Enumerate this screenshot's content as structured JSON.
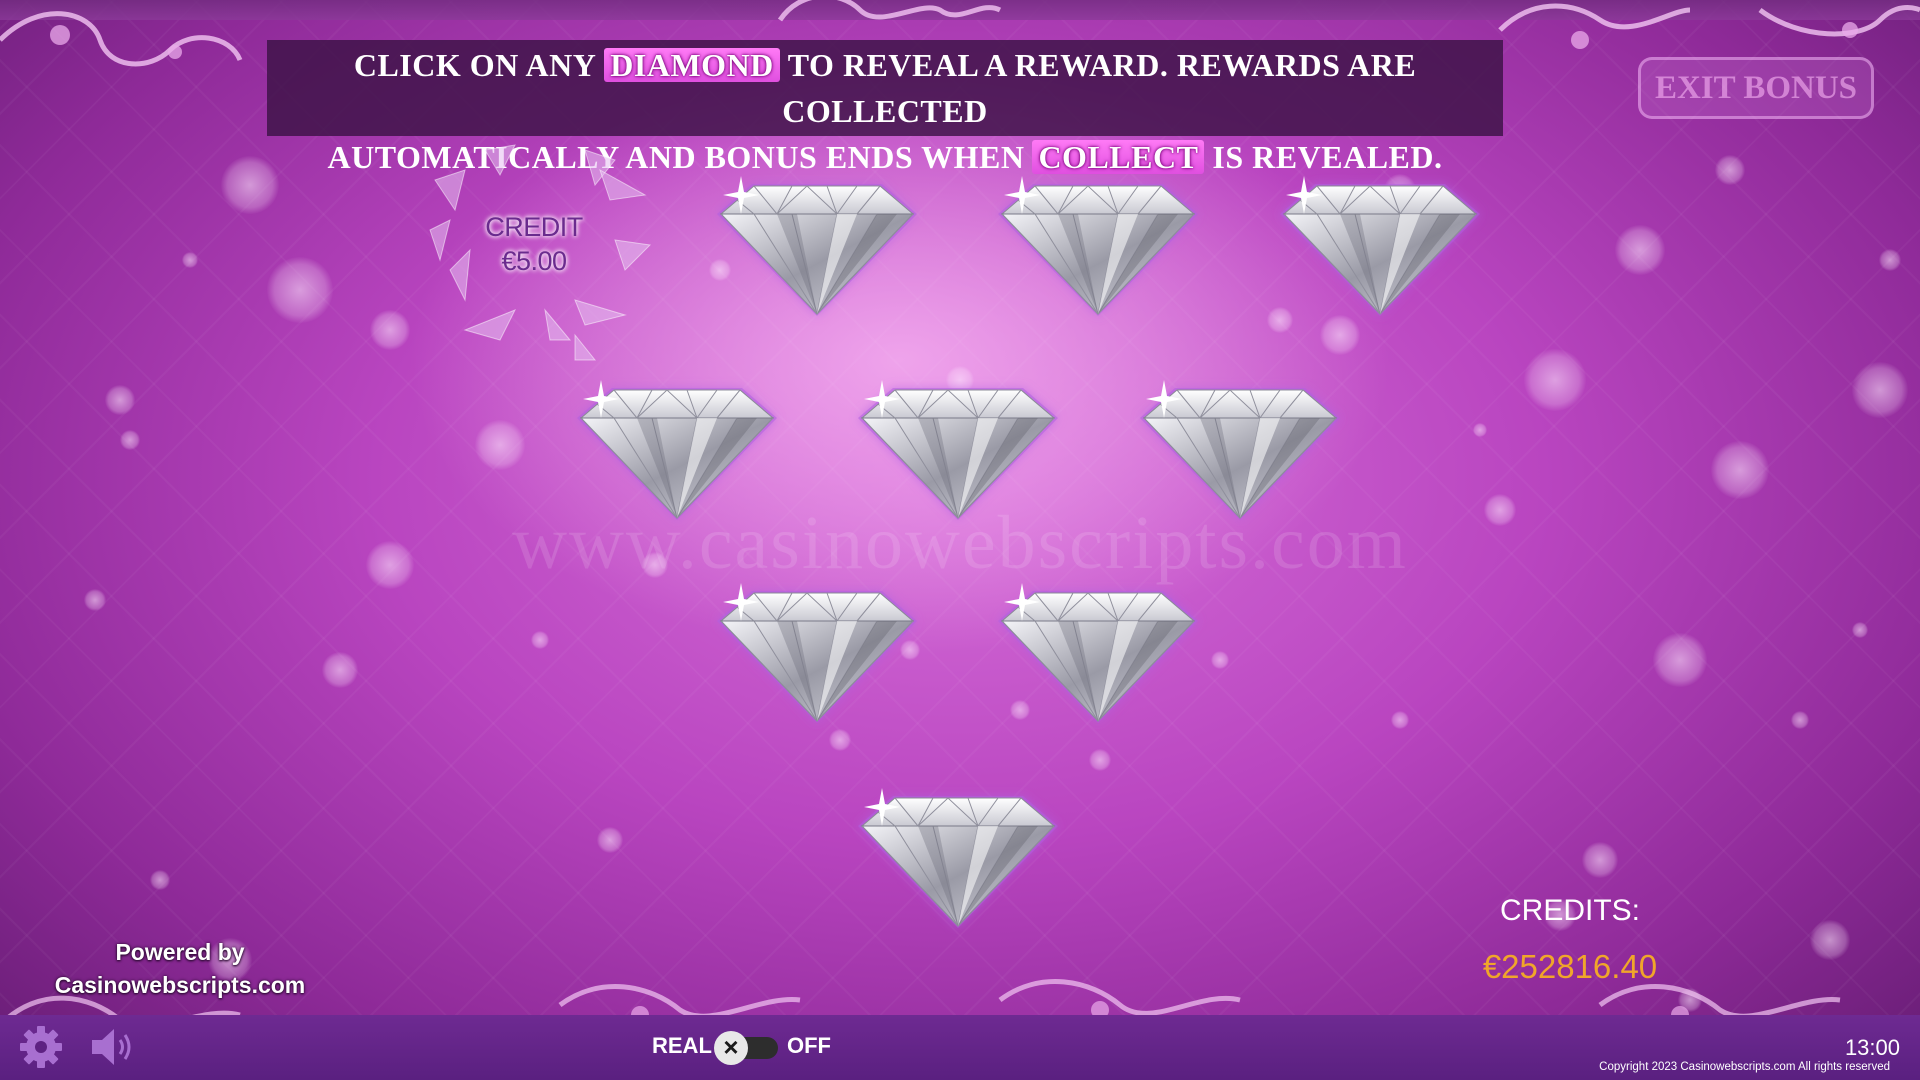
{
  "banner": {
    "line1_before": "CLICK ON ANY",
    "line1_highlight": "DIAMOND",
    "line1_after": "TO REVEAL A REWARD. REWARDS ARE COLLECTED",
    "line2_before": "AUTOMATICALLY AND BONUS ENDS WHEN",
    "line2_highlight": "COLLECT",
    "line2_after": "IS REVEALED."
  },
  "exit_button_label": "EXIT BONUS",
  "revealed_reward": {
    "label": "CREDIT",
    "amount": "€5.00"
  },
  "diamonds": {
    "rows": [
      {
        "row": 1,
        "count": 3
      },
      {
        "row": 2,
        "count": 3
      },
      {
        "row": 3,
        "count": 2
      },
      {
        "row": 4,
        "count": 1
      }
    ],
    "unrevealed_count": 9,
    "revealed_count": 1
  },
  "watermark": "www.casinowebscripts.com",
  "credits": {
    "label": "CREDITS:",
    "value": "€252816.40"
  },
  "powered_by": {
    "line1": "Powered by",
    "line2": "Casinowebscripts.com"
  },
  "bottom_bar": {
    "real_label": "REAL",
    "toggle_state": "off",
    "toggle_icon": "x-icon",
    "off_label": "OFF",
    "clock": "13:00",
    "copyright": "Copyright 2023 Casinowebscripts.com All rights reserved",
    "settings_icon": "gear-icon",
    "sound_icon": "speaker-icon"
  },
  "colors": {
    "background": "#b945c0",
    "banner_bg": "#3c1246",
    "highlight": "#e04fe0",
    "credit_value": "#f0a62a",
    "bottom_bar": "#6e2a92"
  }
}
